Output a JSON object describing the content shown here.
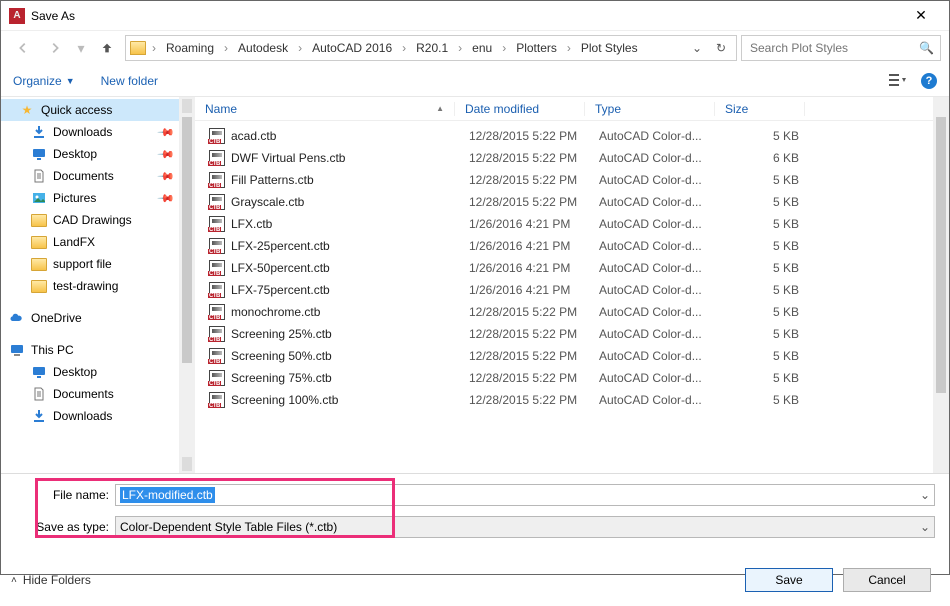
{
  "window": {
    "title": "Save As"
  },
  "breadcrumbs": [
    "Roaming",
    "Autodesk",
    "AutoCAD 2016",
    "R20.1",
    "enu",
    "Plotters",
    "Plot Styles"
  ],
  "search": {
    "placeholder": "Search Plot Styles"
  },
  "toolbar": {
    "organize": "Organize",
    "new_folder": "New folder"
  },
  "sidebar": {
    "quick_access": "Quick access",
    "downloads": "Downloads",
    "desktop": "Desktop",
    "documents": "Documents",
    "pictures": "Pictures",
    "cad_drawings": "CAD Drawings",
    "landfx": "LandFX",
    "support_file": "support file",
    "test_drawing": "test-drawing",
    "onedrive": "OneDrive",
    "this_pc": "This PC",
    "pc_desktop": "Desktop",
    "pc_documents": "Documents",
    "pc_downloads": "Downloads"
  },
  "columns": {
    "name": "Name",
    "date": "Date modified",
    "type": "Type",
    "size": "Size"
  },
  "files": [
    {
      "name": "acad.ctb",
      "date": "12/28/2015 5:22 PM",
      "type": "AutoCAD Color-d...",
      "size": "5 KB"
    },
    {
      "name": "DWF Virtual Pens.ctb",
      "date": "12/28/2015 5:22 PM",
      "type": "AutoCAD Color-d...",
      "size": "6 KB"
    },
    {
      "name": "Fill Patterns.ctb",
      "date": "12/28/2015 5:22 PM",
      "type": "AutoCAD Color-d...",
      "size": "5 KB"
    },
    {
      "name": "Grayscale.ctb",
      "date": "12/28/2015 5:22 PM",
      "type": "AutoCAD Color-d...",
      "size": "5 KB"
    },
    {
      "name": "LFX.ctb",
      "date": "1/26/2016 4:21 PM",
      "type": "AutoCAD Color-d...",
      "size": "5 KB"
    },
    {
      "name": "LFX-25percent.ctb",
      "date": "1/26/2016 4:21 PM",
      "type": "AutoCAD Color-d...",
      "size": "5 KB"
    },
    {
      "name": "LFX-50percent.ctb",
      "date": "1/26/2016 4:21 PM",
      "type": "AutoCAD Color-d...",
      "size": "5 KB"
    },
    {
      "name": "LFX-75percent.ctb",
      "date": "1/26/2016 4:21 PM",
      "type": "AutoCAD Color-d...",
      "size": "5 KB"
    },
    {
      "name": "monochrome.ctb",
      "date": "12/28/2015 5:22 PM",
      "type": "AutoCAD Color-d...",
      "size": "5 KB"
    },
    {
      "name": "Screening 25%.ctb",
      "date": "12/28/2015 5:22 PM",
      "type": "AutoCAD Color-d...",
      "size": "5 KB"
    },
    {
      "name": "Screening 50%.ctb",
      "date": "12/28/2015 5:22 PM",
      "type": "AutoCAD Color-d...",
      "size": "5 KB"
    },
    {
      "name": "Screening 75%.ctb",
      "date": "12/28/2015 5:22 PM",
      "type": "AutoCAD Color-d...",
      "size": "5 KB"
    },
    {
      "name": "Screening 100%.ctb",
      "date": "12/28/2015 5:22 PM",
      "type": "AutoCAD Color-d...",
      "size": "5 KB"
    }
  ],
  "form": {
    "file_name_label": "File name:",
    "file_name_value": "LFX-modified.ctb",
    "save_type_label": "Save as type:",
    "save_type_value": "Color-Dependent Style Table Files (*.ctb)"
  },
  "actions": {
    "hide_folders": "Hide Folders",
    "save": "Save",
    "cancel": "Cancel"
  }
}
